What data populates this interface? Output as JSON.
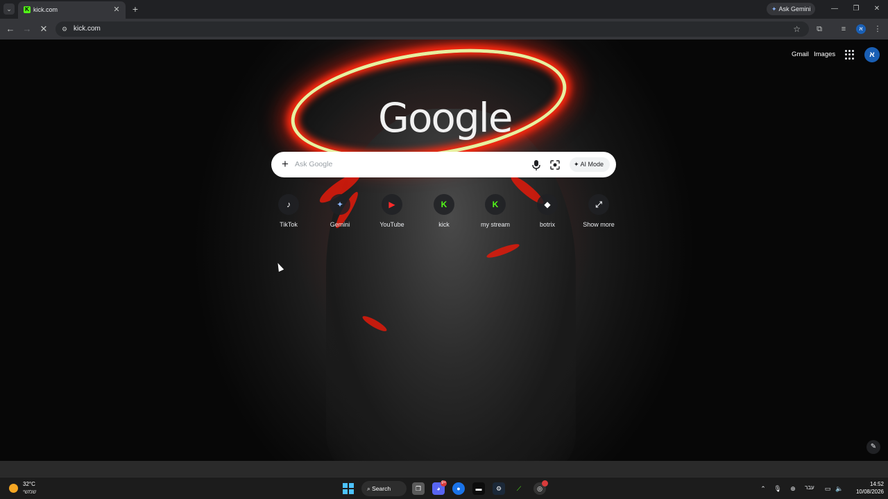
{
  "browser": {
    "tab": {
      "title": "kick.com"
    },
    "ask_gemini_label": "Ask Gemini",
    "address": "kick.com"
  },
  "ntp": {
    "gmail_label": "Gmail",
    "images_label": "Images",
    "account_initial": "א",
    "logo_text": "Google",
    "search": {
      "placeholder": "Ask Google",
      "ai_mode_label": "AI Mode"
    },
    "shortcuts": [
      {
        "label": "TikTok",
        "glyph": "♪",
        "color": "#ffffff"
      },
      {
        "label": "Gemini",
        "glyph": "✦",
        "color": "#8ab4f8"
      },
      {
        "label": "YouTube",
        "glyph": "▶",
        "color": "#ff0000"
      },
      {
        "label": "kick",
        "glyph": "K",
        "color": "#53fc18"
      },
      {
        "label": "my stream",
        "glyph": "K",
        "color": "#53fc18"
      },
      {
        "label": "botrix",
        "glyph": "◆",
        "color": "#ffffff"
      },
      {
        "label": "Show more",
        "glyph": "⤢",
        "color": "#e8eaed"
      }
    ]
  },
  "taskbar": {
    "weather_temp": "32°C",
    "weather_desc": "שמשי",
    "search_label": "Search",
    "discord_badge": "9+",
    "language": "עבר",
    "time": "14:52",
    "date": "10/08/2026"
  },
  "colors": {
    "accent_green": "#53fc18",
    "halo_red": "#ff2a10",
    "windows_blue": "#4cc2ff"
  }
}
